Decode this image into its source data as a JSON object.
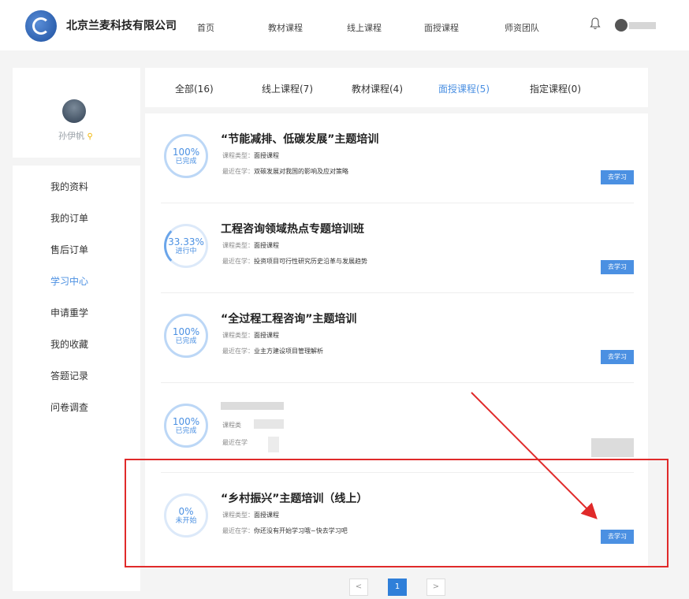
{
  "header": {
    "company": "北京兰麦科技有限公司",
    "nav": [
      "首页",
      "教材课程",
      "线上课程",
      "面授课程",
      "师资团队"
    ],
    "bell_icon": "bell-icon"
  },
  "profile": {
    "name": "孙伊帆",
    "pin_icon": "location-pin-icon"
  },
  "sidebar": {
    "items": [
      {
        "label": "我的资料"
      },
      {
        "label": "我的订单"
      },
      {
        "label": "售后订单"
      },
      {
        "label": "学习中心"
      },
      {
        "label": "申请重学"
      },
      {
        "label": "我的收藏"
      },
      {
        "label": "答题记录"
      },
      {
        "label": "问卷调查"
      }
    ],
    "active": "学习中心"
  },
  "tabs": [
    {
      "label": "全部(16)"
    },
    {
      "label": "线上课程(7)"
    },
    {
      "label": "教材课程(4)"
    },
    {
      "label": "面授课程(5)"
    },
    {
      "label": "指定课程(0)"
    }
  ],
  "active_tab": "面授课程(5)",
  "course_type_label": "课程类型：",
  "recent_label": "最近在学：",
  "button_label": "去学习",
  "courses": [
    {
      "progress": "100%",
      "status": "已完成",
      "title": "“节能减排、低碳发展”主题培训",
      "type": "面授课程",
      "recent": "双碳发展对我国的影响及应对策略"
    },
    {
      "progress": "33.33%",
      "status": "进行中",
      "title": "工程咨询领域热点专题培训班",
      "type": "面授课程",
      "recent": "投资项目可行性研究历史沿革与发展趋势"
    },
    {
      "progress": "100%",
      "status": "已完成",
      "title": "“全过程工程咨询”主题培训",
      "type": "面授课程",
      "recent": "业主方建设项目管理解析"
    },
    {
      "progress": "100%",
      "status": "已完成",
      "type_label_partial": "课程类",
      "recent_label": "最近在学"
    },
    {
      "progress": "0%",
      "status": "未开始",
      "title": "“乡村振兴”主题培训（线上）",
      "type": "面授课程",
      "recent": "你还没有开始学习哦~快去学习吧"
    }
  ],
  "pagination": {
    "prev": "<",
    "current": "1",
    "next": ">"
  },
  "colors": {
    "accent": "#4b90e2",
    "annotation": "#e02a2a"
  }
}
